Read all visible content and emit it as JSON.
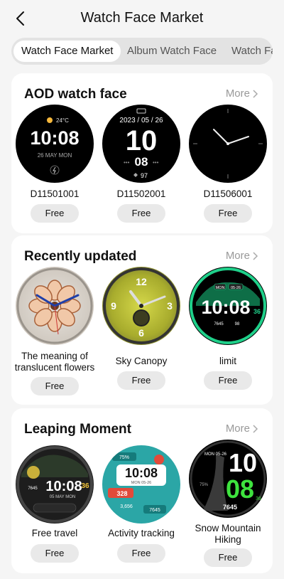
{
  "header": {
    "title": "Watch Face Market"
  },
  "tabs": [
    {
      "label": "Watch Face Market",
      "active": true
    },
    {
      "label": "Album Watch Face",
      "active": false
    },
    {
      "label": "Watch Fa",
      "active": false
    }
  ],
  "sections": [
    {
      "title": "AOD watch face",
      "more": "More",
      "items": [
        {
          "name": "D11501001",
          "price": "Free",
          "face": {
            "weather": "24°C",
            "time": "10:08",
            "date": "26 MAY MON"
          }
        },
        {
          "name": "D11502001",
          "price": "Free",
          "face": {
            "date": "2023 / 05 / 26",
            "hour": "10",
            "minute": "08",
            "heart": "97"
          }
        },
        {
          "name": "D11506001",
          "price": "Free",
          "face": {}
        }
      ]
    },
    {
      "title": "Recently updated",
      "more": "More",
      "items": [
        {
          "name": "The meaning of translucent flowers",
          "price": "Free"
        },
        {
          "name": "Sky Canopy",
          "price": "Free",
          "face": {
            "n12": "12",
            "n3": "3",
            "n6": "6",
            "n9": "9"
          }
        },
        {
          "name": "limit",
          "price": "Free",
          "face": {
            "label1": "MON",
            "label2": "05-26",
            "time": "10:08",
            "sec": "36",
            "steps": "7645",
            "hr": "98"
          }
        }
      ]
    },
    {
      "title": "Leaping Moment",
      "more": "More",
      "items": [
        {
          "name": "Free travel",
          "price": "Free",
          "face": {
            "time": "10:08",
            "date": "05 MAY MON",
            "sec": "36",
            "steps": "7645"
          }
        },
        {
          "name": "Activity tracking",
          "price": "Free",
          "face": {
            "pct": "75%",
            "time": "10:08",
            "date": "MON 05-26",
            "val1": "328",
            "val2": "3,656",
            "val3": "7645"
          }
        },
        {
          "name": "Snow Mountain Hiking",
          "price": "Free",
          "face": {
            "date": "MON 05-26",
            "hour": "10",
            "minute": "08",
            "sec": "36",
            "steps": "7645",
            "pct": "75%"
          }
        }
      ]
    }
  ]
}
